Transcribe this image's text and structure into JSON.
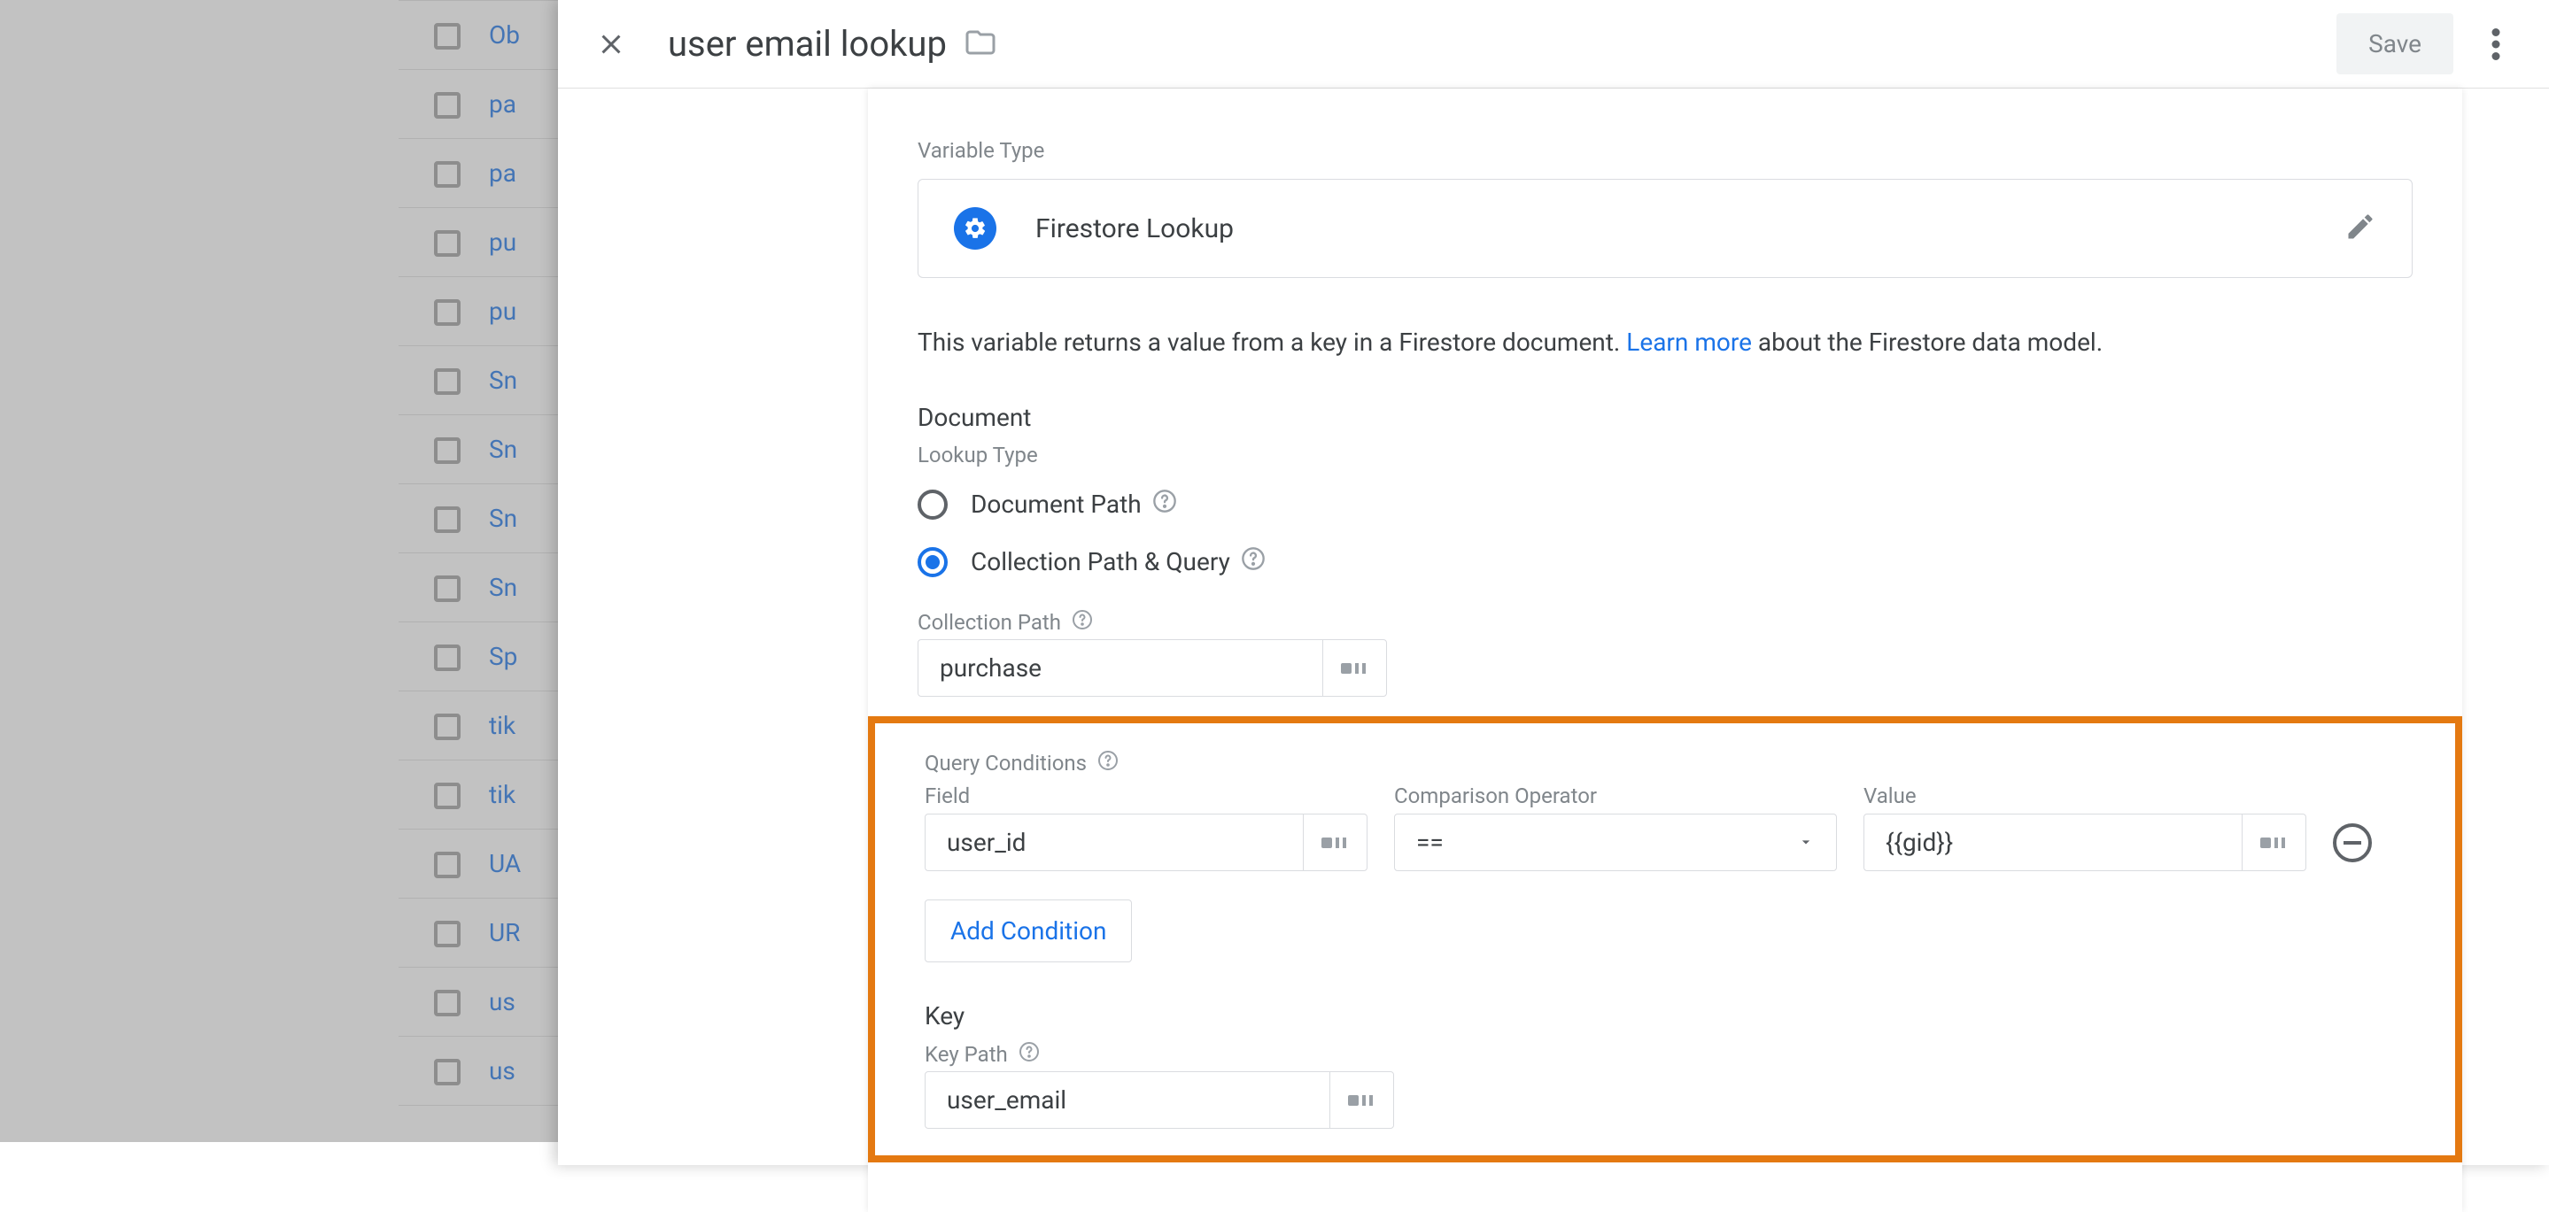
{
  "bg_items": [
    "Ob",
    "pa",
    "pa",
    "pu",
    "pu",
    "Sn",
    "Sn",
    "Sn",
    "Sn",
    "Sp",
    "tik",
    "tik",
    "UA",
    "UR",
    "us",
    "us"
  ],
  "header": {
    "title": "user email lookup",
    "save_label": "Save"
  },
  "variable": {
    "section_label": "Variable Type",
    "type_name": "Firestore Lookup",
    "desc_pre": "This variable returns a value from a key in a Firestore document. ",
    "desc_link": "Learn more",
    "desc_post": " about the Firestore data model."
  },
  "document": {
    "title": "Document",
    "lookup_type_label": "Lookup Type",
    "option_doc_path": "Document Path",
    "option_coll_query": "Collection Path & Query",
    "collection_path_label": "Collection Path",
    "collection_path_value": "purchase"
  },
  "query": {
    "title": "Query Conditions",
    "field_label": "Field",
    "field_value": "user_id",
    "op_label": "Comparison Operator",
    "op_value": "==",
    "value_label": "Value",
    "value_value": "{{gid}}",
    "add_condition_label": "Add Condition"
  },
  "key": {
    "title": "Key",
    "key_path_label": "Key Path",
    "key_path_value": "user_email"
  }
}
